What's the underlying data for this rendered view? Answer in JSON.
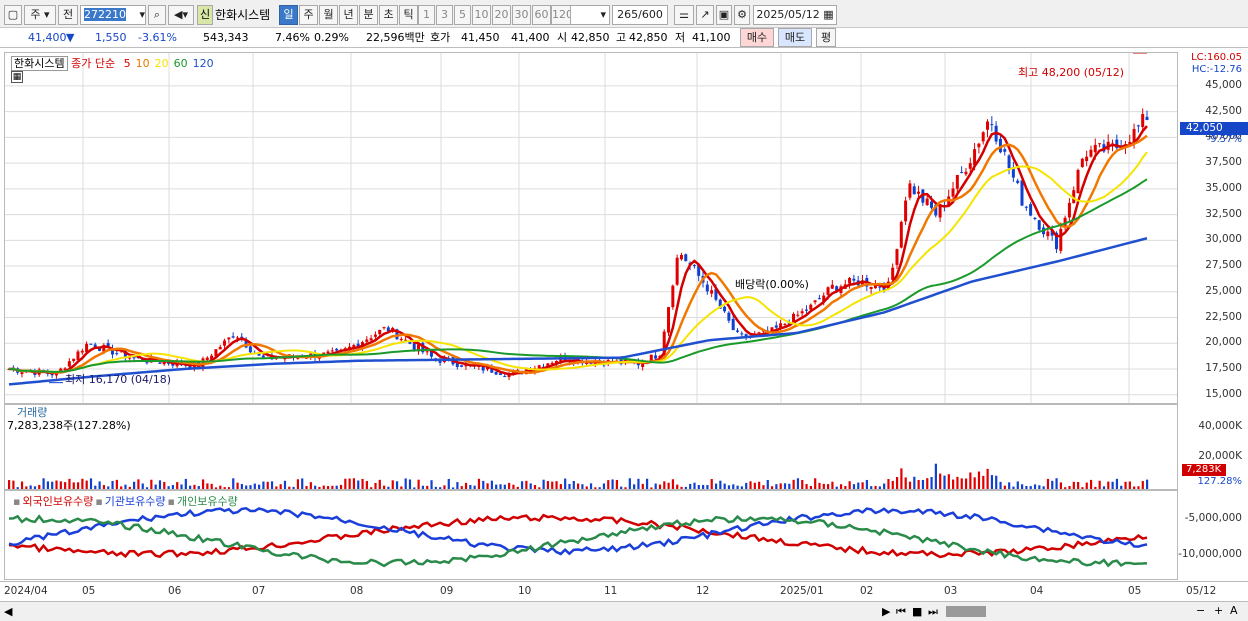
{
  "toolbar": {
    "period_select": "주",
    "prev": "전",
    "stock_code": "272210",
    "stock_new_badge": "신",
    "stock_name": "한화시스템",
    "tf": [
      {
        "label": "일",
        "active": true
      },
      {
        "label": "주"
      },
      {
        "label": "월"
      },
      {
        "label": "년"
      },
      {
        "label": "분"
      },
      {
        "label": "초"
      },
      {
        "label": "틱"
      }
    ],
    "nums": [
      "1",
      "3",
      "5",
      "10",
      "20",
      "30",
      "60",
      "120"
    ],
    "count": "265",
    "count_max": "/600",
    "date": "2025/05/12"
  },
  "quote": {
    "price": "41,400",
    "arrow": "▼",
    "change": "1,550",
    "rate": "-3.61%",
    "volume": "543,343",
    "turnover_rate": "7.46%",
    "vol_ratio": "0.29%",
    "amount": "22,596백만",
    "bid_label": "호가",
    "bid": "41,450",
    "ask": "41,400",
    "open_label": "시",
    "open": "42,850",
    "high_label": "고",
    "high": "42,850",
    "low_label": "저",
    "low": "41,100",
    "buy": "매수",
    "sell": "매도",
    "avg": "평"
  },
  "price_pane": {
    "legend_name": "한화시스템",
    "legend_ma": "종가 단순",
    "ma_periods": [
      "5",
      "10",
      "20",
      "60",
      "120"
    ],
    "ma_colors": [
      "#d40000",
      "#f07800",
      "#f5e400",
      "#1a9a2a",
      "#2050d0"
    ],
    "high_note": "최고 48,200 (05/12)",
    "low_note": "최저 16,170 (04/18)",
    "dividend_note": "배당락(0.00%)",
    "lc": "LC:160.05",
    "hc": "HC:-12.76",
    "current_price_tag": "42,050",
    "current_pct": "-9.57%",
    "y_ticks": [
      "45,000",
      "42,500",
      "40,000",
      "37,500",
      "35,000",
      "32,500",
      "30,000",
      "27,500",
      "25,000",
      "22,500",
      "20,000",
      "17,500",
      "15,000"
    ]
  },
  "volume_pane": {
    "title": "거래량",
    "value": "7,283,238주(127.28%)",
    "y_ticks": [
      "40,000K",
      "20,000K"
    ],
    "tag": "7,283K",
    "tag_pct": "127.28%"
  },
  "holding_pane": {
    "items": [
      {
        "label": "외국인보유수량",
        "color": "#d00000"
      },
      {
        "label": "기관보유수량",
        "color": "#1a3fd8"
      },
      {
        "label": "개인보유수량",
        "color": "#2a8a4a"
      }
    ],
    "y_ticks": [
      "-5,000,000",
      "-10,000,000"
    ]
  },
  "x_axis": [
    "2024/04",
    "05",
    "06",
    "07",
    "08",
    "09",
    "10",
    "11",
    "12",
    "2025/01",
    "02",
    "03",
    "04",
    "05",
    "05/12"
  ],
  "chart_data": {
    "type": "candlestick",
    "title": "한화시스템",
    "x": [
      "2024/04",
      "05",
      "06",
      "07",
      "08",
      "09",
      "10",
      "11",
      "12",
      "2025/01",
      "02",
      "03",
      "04",
      "05"
    ],
    "price_close": [
      17000,
      19500,
      18500,
      19000,
      19500,
      18500,
      18300,
      18000,
      27000,
      22000,
      25000,
      38000,
      33000,
      42050
    ],
    "ma120": [
      16000,
      16800,
      17500,
      18000,
      18300,
      18400,
      18500,
      18600,
      20300,
      21000,
      23000,
      26000,
      28000,
      30200
    ],
    "ylim": [
      14000,
      48200
    ]
  }
}
